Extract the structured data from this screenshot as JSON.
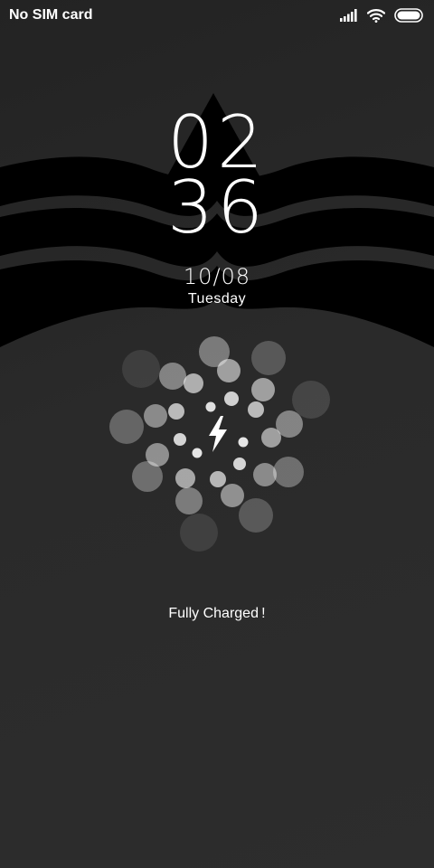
{
  "status_bar": {
    "carrier": "No SIM card",
    "signal_icon": "signal-bars-icon",
    "wifi_icon": "wifi-icon",
    "battery_icon": "battery-full-icon"
  },
  "lockscreen": {
    "clock_hours": "02",
    "clock_minutes": "36",
    "date": "10/08",
    "weekday": "Tuesday",
    "charge_status": "Fully Charged !",
    "battery_level": 1.0,
    "charging_icon": "lightning-bolt-icon"
  },
  "colors": {
    "background": "#262626",
    "wave": "#000000",
    "text": "#ffffff"
  }
}
